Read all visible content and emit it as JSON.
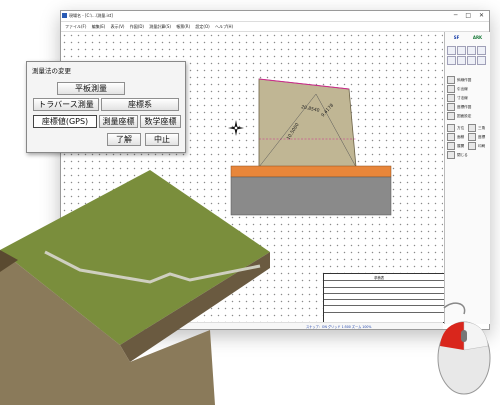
{
  "window": {
    "title": "現場名 - [C:\\...\\測量.ist]",
    "controls": "─ □ ✕"
  },
  "menu": [
    "ファイル(F)",
    "編集(E)",
    "表示(V)",
    "作図(D)",
    "測量計算(S)",
    "帳票(R)",
    "設定(O)",
    "ヘルプ(H)"
  ],
  "dialog": {
    "title": "測量法の変更",
    "plane_survey_label": "平板測量",
    "traverse_label": "トラバース測量",
    "coordinate_system_label": "座標系",
    "gps_label": "座標値(GPS)",
    "survey_coord_label": "測量座標",
    "math_coord_label": "数学座標",
    "ok_label": "了解",
    "cancel_label": "中止"
  },
  "toolbar_right": {
    "logos": [
      "SF",
      "ARK"
    ],
    "items": [
      "斜線作図",
      "引出線",
      "寸法線",
      "座標作図",
      "図面設定",
      "方位",
      "三角",
      "面積",
      "座標",
      "展開",
      "印刷",
      "閉じる"
    ]
  },
  "drawing": {
    "dims": [
      "10.5000",
      "9.4178",
      "20.8540"
    ],
    "table_title": "求積表"
  },
  "statusbar": {
    "text": "スナップ：ON   グリッド   1:500   ズーム 100%"
  },
  "colors": {
    "parcel": "#c0b694",
    "orange_band": "#e8863a",
    "gray_band": "#8a8a8a",
    "terrain_top": "#7a8e3c",
    "mouse_red": "#d9261c"
  }
}
